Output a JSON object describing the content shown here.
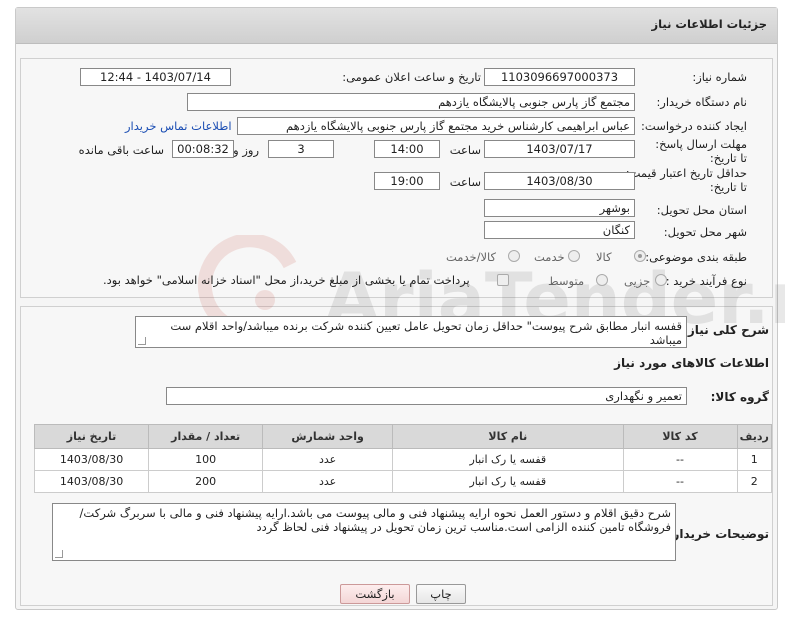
{
  "header": {
    "title": "جزئیات اطلاعات نیاز"
  },
  "info": {
    "need_number_label": "شماره نیاز:",
    "need_number": "1103096697000373",
    "announce_label": "تاریخ و ساعت اعلان عمومی:",
    "announce_value": "1403/07/14 - 12:44",
    "buyer_label": "نام دستگاه خریدار:",
    "buyer_value": "مجتمع گاز پارس جنوبی  پالایشگاه یازدهم",
    "requester_label": "ایجاد کننده درخواست:",
    "requester_value": "عباس ابراهیمی کارشناس خرید مجتمع گاز پارس جنوبی  پالایشگاه یازدهم",
    "contact_link": "اطلاعات تماس خریدار",
    "reply_deadline_label": "مهلت ارسال پاسخ: تا تاریخ:",
    "reply_date": "1403/07/17",
    "time_label": "ساعت",
    "reply_time": "14:00",
    "days_value": "3",
    "days_label": "روز و",
    "remaining_time": "00:08:32",
    "remaining_label": "ساعت باقی مانده",
    "price_validity_label": "حداقل تاریخ اعتبار قیمت: تا تاریخ:",
    "validity_date": "1403/08/30",
    "time_label2": "ساعت",
    "validity_time": "19:00",
    "province_label": "استان محل تحویل:",
    "province_value": "بوشهر",
    "city_label": "شهر محل تحویل:",
    "city_value": "کنگان",
    "category_label": "طبقه بندی موضوعی:",
    "category_options": [
      "کالا",
      "خدمت",
      "کالا/خدمت"
    ],
    "category_selected": "کالا",
    "process_label": "نوع فرآیند خرید :",
    "process_options": [
      "جزیی",
      "متوسط"
    ],
    "payment_note": "پرداخت تمام یا بخشی از مبلغ خرید،از محل \"اسناد خزانه اسلامی\" خواهد بود."
  },
  "description": {
    "general_label": "شرح کلی نیاز:",
    "general_value": "قفسه انبار مطابق شرح پیوست\" حداقل زمان تحویل عامل تعیین کننده شرکت برنده میباشد/واحد اقلام ست میباشد",
    "goods_info_title": "اطلاعات کالاهای مورد نیاز",
    "goods_group_label": "گروه کالا:",
    "goods_group_value": "تعمیر و نگهداری",
    "buyer_notes_label": "توضیحات خریدار:",
    "buyer_notes_value": "شرح دقیق اقلام و دستور العمل نحوه ارایه پیشنهاد فنی و مالی پیوست می باشد.ارایه پیشنهاد فنی و مالی با سربرگ شرکت/فروشگاه تامین کننده الزامی است.مناسب ترین زمان تحویل در پیشنهاد فنی لحاظ گردد"
  },
  "table": {
    "headers": [
      "ردیف",
      "کد کالا",
      "نام کالا",
      "واحد شمارش",
      "تعداد / مقدار",
      "تاریخ نیاز"
    ],
    "rows": [
      [
        "1",
        "--",
        "قفسه یا رک انبار",
        "عدد",
        "100",
        "1403/08/30"
      ],
      [
        "2",
        "--",
        "قفسه یا رک انبار",
        "عدد",
        "200",
        "1403/08/30"
      ]
    ]
  },
  "buttons": {
    "print": "چاپ",
    "back": "بازگشت"
  },
  "watermark": {
    "text": "AriaTender.neT"
  }
}
